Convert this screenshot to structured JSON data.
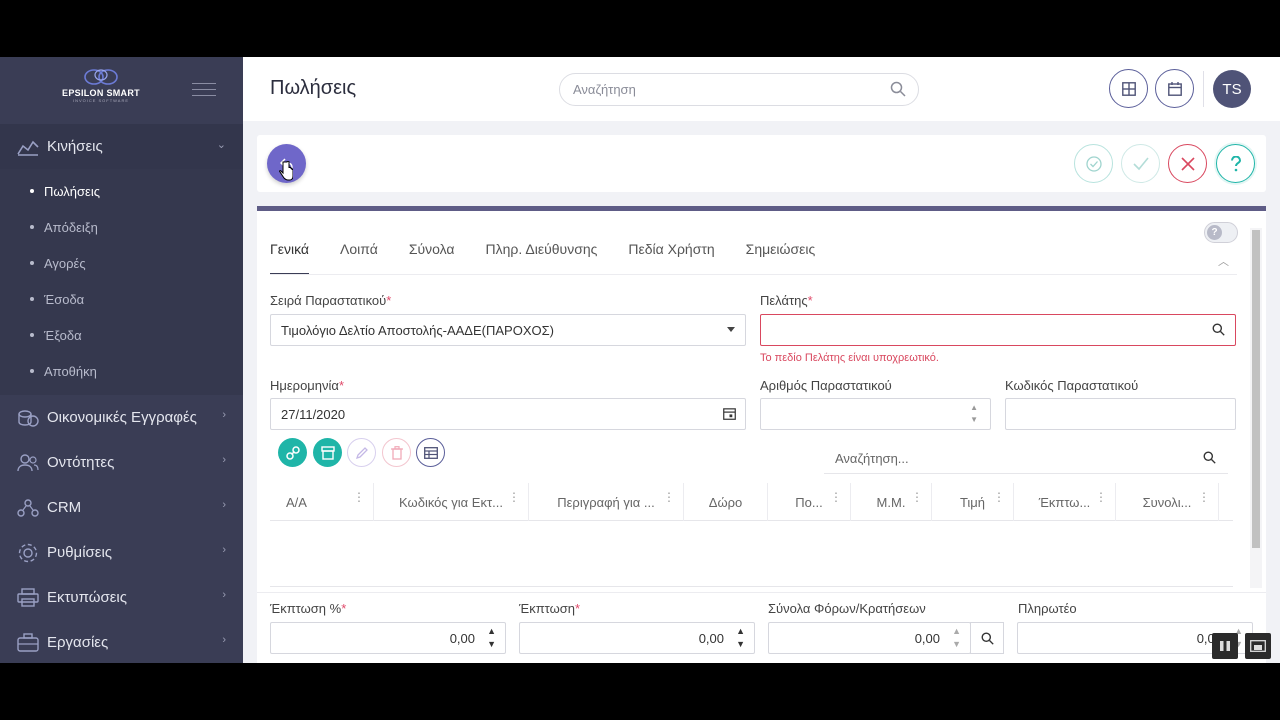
{
  "app": {
    "brand_name": "EPSILON SMART",
    "brand_sub": "INVOICE SOFTWARE",
    "page_title": "Πωλήσεις",
    "user_initials": "TS"
  },
  "header": {
    "search_placeholder": "Αναζήτηση"
  },
  "sidebar": {
    "groups": [
      {
        "label": "Κινήσεις",
        "icon": "chart-icon",
        "expanded": true
      },
      {
        "label": "Οικονομικές Εγγραφές",
        "icon": "coins-icon"
      },
      {
        "label": "Οντότητες",
        "icon": "users-icon"
      },
      {
        "label": "CRM",
        "icon": "crm-icon"
      },
      {
        "label": "Ρυθμίσεις",
        "icon": "gear-icon"
      },
      {
        "label": "Εκτυπώσεις",
        "icon": "printer-icon"
      },
      {
        "label": "Εργασίες",
        "icon": "briefcase-icon"
      }
    ],
    "sub_items": [
      "Πωλήσεις",
      "Απόδειξη",
      "Αγορές",
      "Έσοδα",
      "Έξοδα",
      "Αποθήκη"
    ]
  },
  "tabs": [
    "Γενικά",
    "Λοιπά",
    "Σύνολα",
    "Πληρ. Διεύθυνσης",
    "Πεδία Χρήστη",
    "Σημειώσεις"
  ],
  "form": {
    "series_label": "Σειρά Παραστατικού",
    "series_value": "Τιμολόγιο Δελτίο Αποστολής-ΑΑΔΕ(ΠΑΡΟΧΟΣ)",
    "customer_label": "Πελάτης",
    "customer_value": "",
    "customer_error": "Το πεδίο Πελάτης είναι υποχρεωτικό.",
    "date_label": "Ημερομηνία",
    "date_value": "27/11/2020",
    "doc_number_label": "Αριθμός Παραστατικού",
    "doc_number_value": "",
    "doc_code_label": "Κωδικός Παραστατικού",
    "doc_code_value": "",
    "required_mark": "*"
  },
  "grid": {
    "search_placeholder": "Αναζήτηση...",
    "columns": [
      "Α/Α",
      "Κωδικός για Εκτ...",
      "Περιγραφή για ...",
      "Δώρο",
      "Πο...",
      "Μ.Μ.",
      "Τιμή",
      "Έκπτω...",
      "Συνολι..."
    ]
  },
  "totals": {
    "discount_pct_label": "Έκπτωση %",
    "discount_pct_value": "0,00",
    "discount_label": "Έκπτωση",
    "discount_value": "0,00",
    "taxes_label": "Σύνολα Φόρων/Κρατήσεων",
    "taxes_value": "0,00",
    "payable_label": "Πληρωτέο",
    "payable_value": "0,00"
  },
  "colors": {
    "sidebar_bg": "#3a3d55",
    "accent_purple": "#6f67c9",
    "teal": "#1fb5a8",
    "error_red": "#d9485f"
  }
}
